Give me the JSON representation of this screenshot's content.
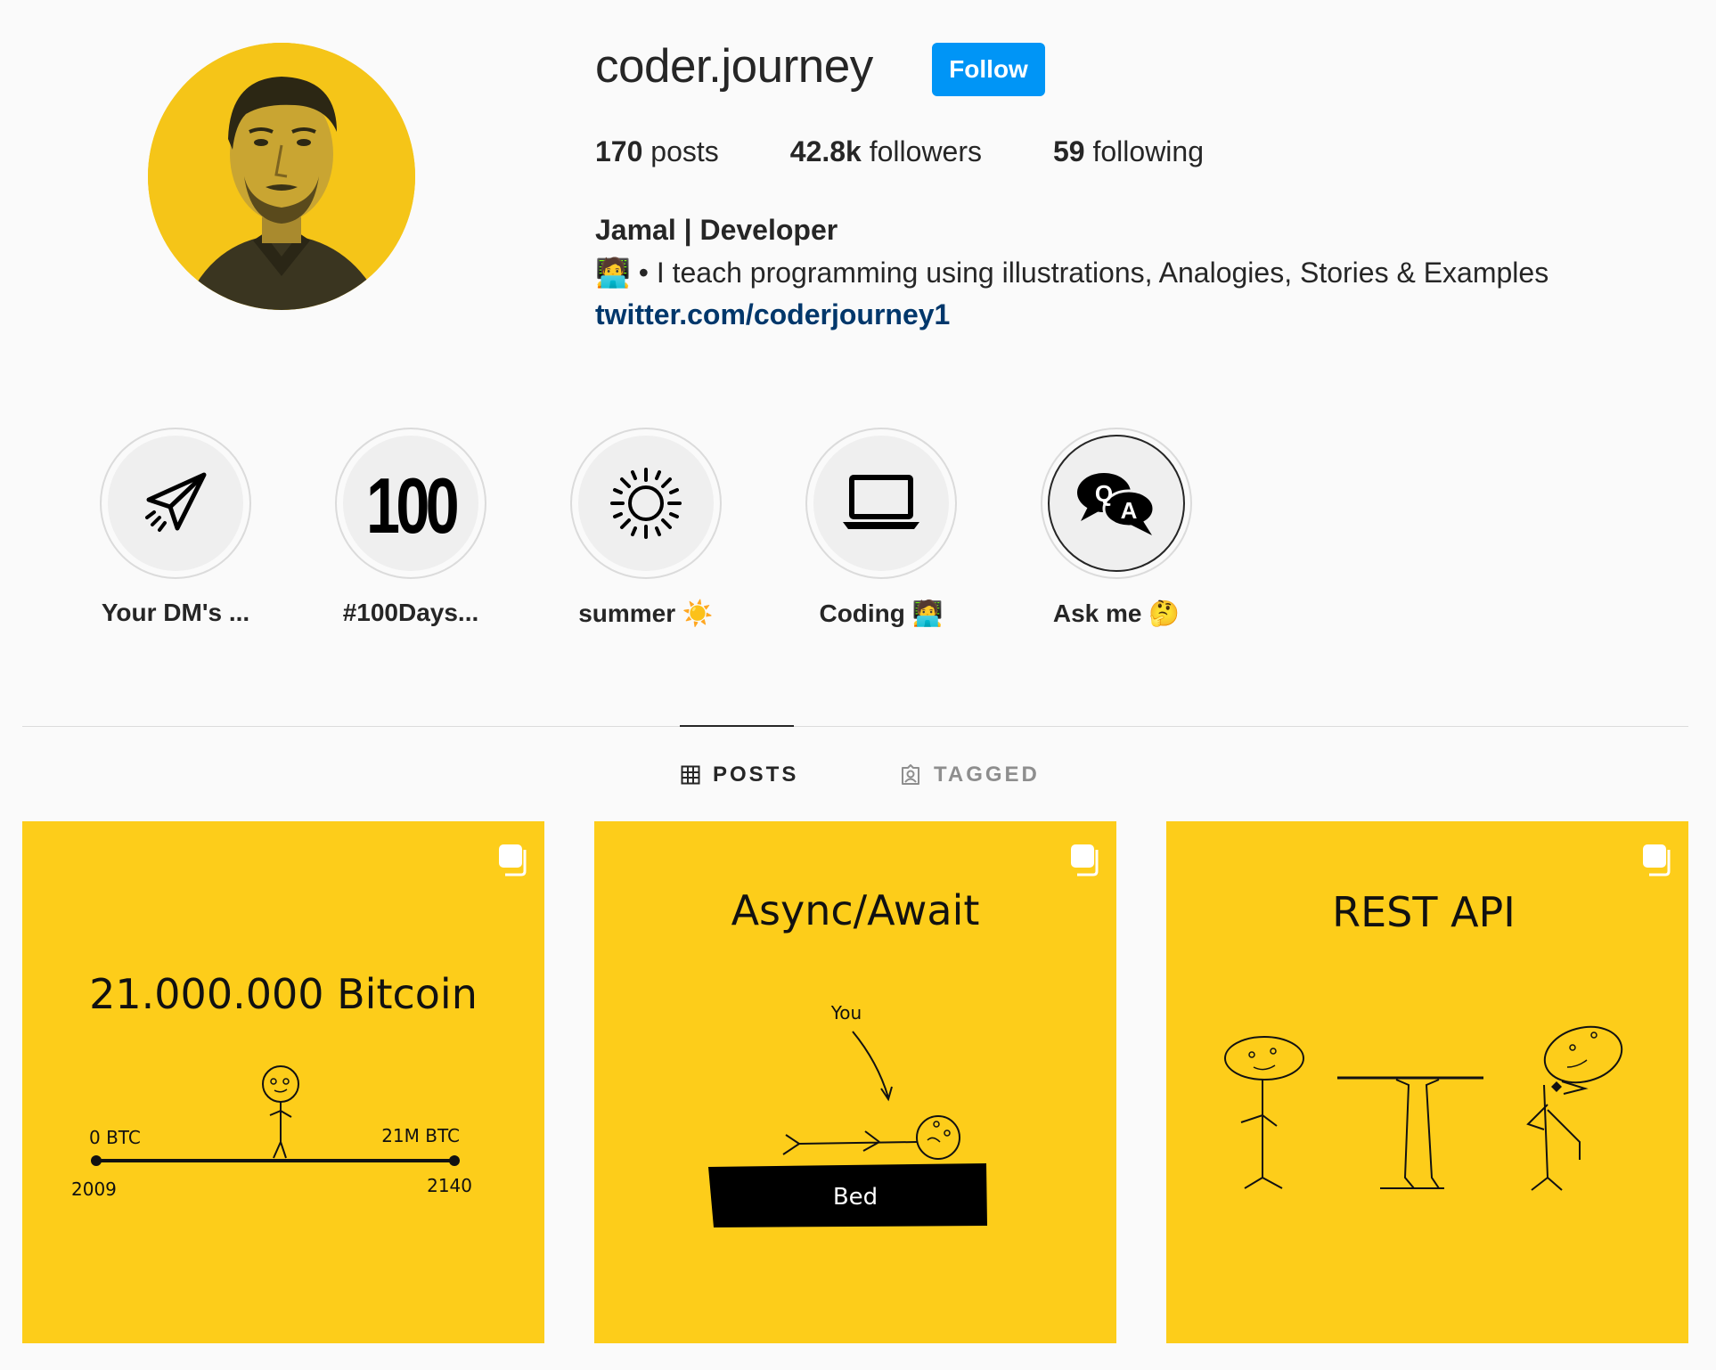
{
  "profile": {
    "username": "coder.journey",
    "follow_label": "Follow",
    "stats": {
      "posts_count": "170",
      "posts_label": " posts",
      "followers_count": "42.8k",
      "followers_label": " followers",
      "following_count": "59",
      "following_label": " following"
    },
    "full_name": "Jamal | Developer",
    "bio": "🧑‍💻 • I teach programming using illustrations, Analogies, Stories & Examples",
    "link": "twitter.com/coderjourney1"
  },
  "highlights": [
    {
      "label": "Your DM's ...",
      "icon": "paper-plane-icon"
    },
    {
      "label": "#100Days...",
      "icon": "100-icon",
      "icon_text": "100"
    },
    {
      "label": "summer ☀️",
      "icon": "sun-icon"
    },
    {
      "label": "Coding 🧑‍💻",
      "icon": "laptop-icon"
    },
    {
      "label": "Ask me 🤔",
      "icon": "qa-chat-icon",
      "icon_text_q": "Q",
      "icon_text_a": "A"
    }
  ],
  "tabs": [
    {
      "label": "POSTS",
      "icon": "grid-icon",
      "active": true
    },
    {
      "label": "TAGGED",
      "icon": "tagged-icon",
      "active": false
    }
  ],
  "posts": [
    {
      "title": "21.000.000 Bitcoin",
      "left_label": "0 BTC",
      "right_label": "21M BTC",
      "left_year": "2009",
      "right_year": "2140",
      "badge": "multiple-posts-icon"
    },
    {
      "title": "Async/Await",
      "pointer_label": "You",
      "bed_label": "Bed",
      "badge": "multiple-posts-icon"
    },
    {
      "title": "REST API",
      "badge": "multiple-posts-icon"
    }
  ],
  "colors": {
    "accent": "#0095f6",
    "link": "#00376b",
    "post_background": "#fdcd1a",
    "avatar_background": "#f5c518"
  }
}
